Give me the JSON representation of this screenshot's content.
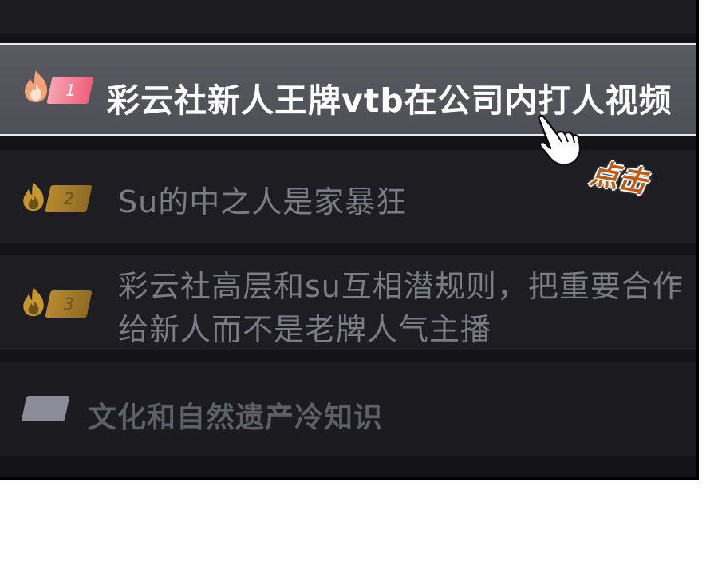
{
  "trending": {
    "items": [
      {
        "rank": "1",
        "title": "彩云社新人王牌vtb在公司内打人视频"
      },
      {
        "rank": "2",
        "title": "Su的中之人是家暴狂"
      },
      {
        "rank": "3",
        "title": "彩云社高层和su互相潜规则，把重要合作给新人而不是老牌人气主播"
      },
      {
        "rank": "",
        "title": "文化和自然遗产冷知识"
      }
    ]
  },
  "annotation": {
    "click_text": "点击"
  },
  "colors": {
    "rank1": "#f06a7e",
    "rank_gold": "#b8892c",
    "rank_gray": "#8a8a96"
  }
}
